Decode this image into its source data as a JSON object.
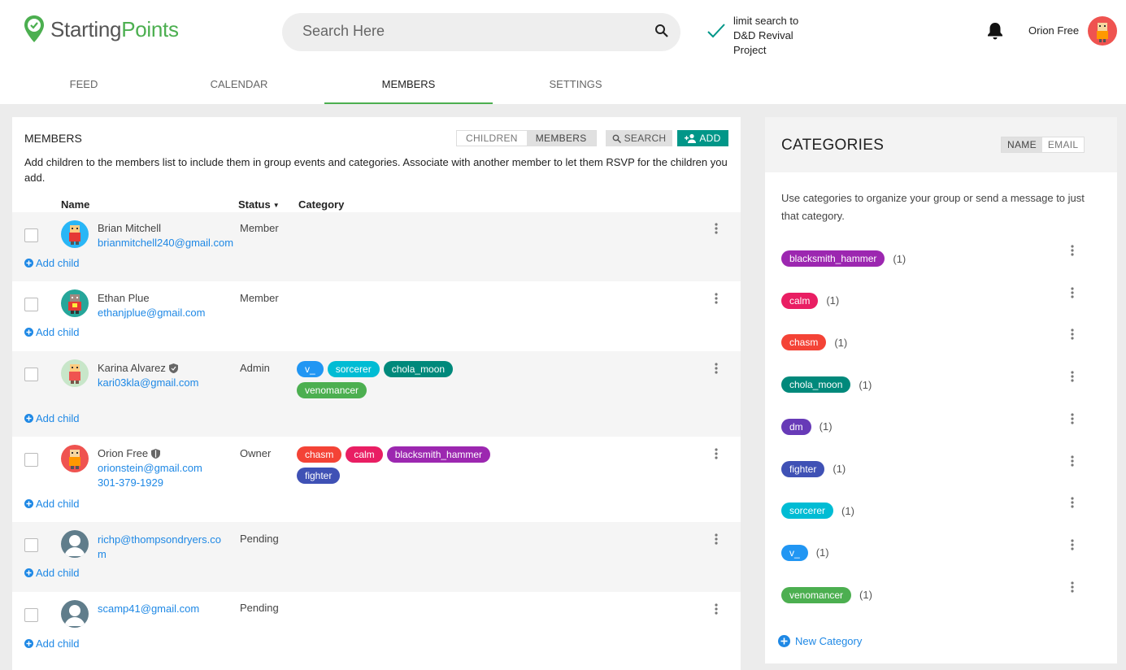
{
  "app": {
    "logo_main": "Starting",
    "logo_accent": "Points"
  },
  "search": {
    "placeholder": "Search Here"
  },
  "limit": {
    "text": "limit search to D&D Revival Project"
  },
  "user": {
    "name": "Orion Free"
  },
  "tabs": [
    {
      "label": "FEED"
    },
    {
      "label": "CALENDAR"
    },
    {
      "label": "MEMBERS",
      "active": true
    },
    {
      "label": "SETTINGS"
    }
  ],
  "members": {
    "title": "MEMBERS",
    "toggle": {
      "children": "CHILDREN",
      "members": "MEMBERS"
    },
    "search_label": "SEARCH",
    "add_label": "ADD",
    "description": "Add children to the members list to include them in group events and categories. Associate with another member to let them RSVP for the children you add.",
    "columns": {
      "name": "Name",
      "status": "Status",
      "category": "Category"
    },
    "add_child_label": "Add child",
    "rows": [
      {
        "name": "Brian Mitchell",
        "email": "brianmitchell240@gmail.com",
        "status": "Member",
        "tags": []
      },
      {
        "name": "Ethan Plue",
        "email": "ethanjplue@gmail.com",
        "status": "Member",
        "tags": []
      },
      {
        "name": "Karina Alvarez",
        "email": "kari03kla@gmail.com",
        "status": "Admin",
        "tags": [
          "v_",
          "sorcerer",
          "chola_moon",
          "venomancer"
        ]
      },
      {
        "name": "Orion Free",
        "email": "orionstein@gmail.com",
        "phone": "301-379-1929",
        "status": "Owner",
        "tags": [
          "chasm",
          "calm",
          "blacksmith_hammer",
          "fighter"
        ]
      },
      {
        "name": "",
        "email": "richp@thompsondryers.com",
        "status": "Pending",
        "tags": []
      },
      {
        "name": "",
        "email": "scamp41@gmail.com",
        "status": "Pending",
        "tags": []
      }
    ]
  },
  "categories": {
    "title": "CATEGORIES",
    "sort": {
      "name": "NAME",
      "email": "EMAIL"
    },
    "description": "Use categories to organize your group or send a message to just that category.",
    "new_label": "New Category",
    "items": [
      {
        "label": "blacksmith_hammer",
        "count": "(1)",
        "color": "#9c27b0"
      },
      {
        "label": "calm",
        "count": "(1)",
        "color": "#e91e63"
      },
      {
        "label": "chasm",
        "count": "(1)",
        "color": "#f44336"
      },
      {
        "label": "chola_moon",
        "count": "(1)",
        "color": "#00897b"
      },
      {
        "label": "dm",
        "count": "(1)",
        "color": "#673ab7"
      },
      {
        "label": "fighter",
        "count": "(1)",
        "color": "#3f51b5"
      },
      {
        "label": "sorcerer",
        "count": "(1)",
        "color": "#00bcd4"
      },
      {
        "label": "v_",
        "count": "(1)",
        "color": "#2196f3"
      },
      {
        "label": "venomancer",
        "count": "(1)",
        "color": "#4caf50"
      }
    ]
  },
  "colors": {
    "accent": "#4caf50",
    "link": "#1e88e5",
    "add_button": "#009688"
  }
}
